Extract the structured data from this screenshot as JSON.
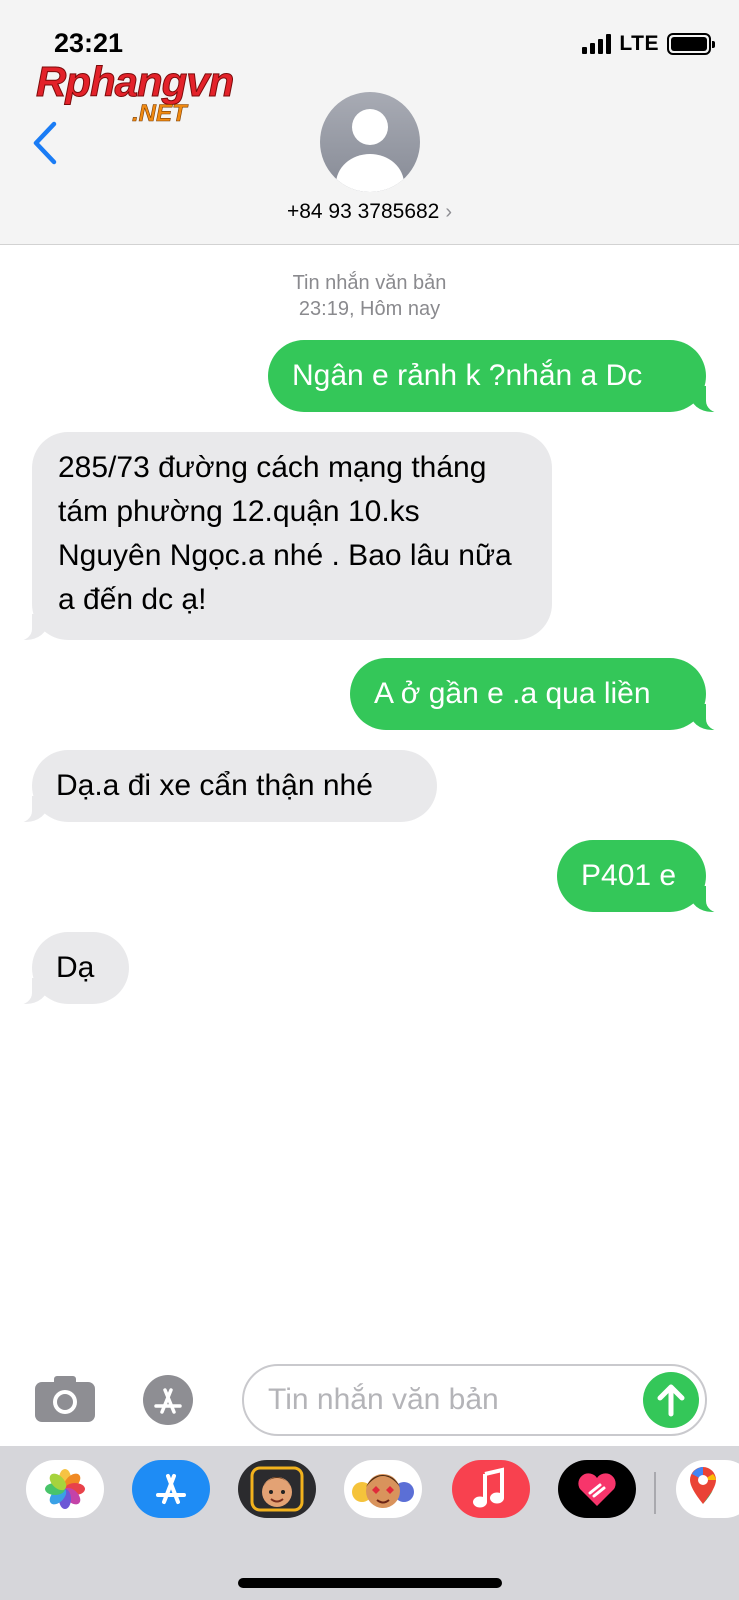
{
  "status_bar": {
    "time": "23:21",
    "network": "LTE"
  },
  "watermark": {
    "top": "Rphangvn",
    "bottom": ".NET"
  },
  "contact": {
    "phone": "+84 93 3785682",
    "chevron": "›"
  },
  "thread": {
    "meta_type": "Tin nhắn văn bản",
    "meta_time": "23:19, Hôm nay"
  },
  "messages": [
    {
      "direction": "outgoing",
      "text": "Ngân e rảnh k ?nhắn a Dc"
    },
    {
      "direction": "incoming",
      "text": "285/73 đường cách mạng tháng tám phường 12.quận 10.ks Nguyên Ngọc.a nhé . Bao lâu nữa a đến dc ạ!"
    },
    {
      "direction": "outgoing",
      "text": "A ở gần e .a qua liền"
    },
    {
      "direction": "incoming",
      "text": "Dạ.a đi xe cẩn thận nhé"
    },
    {
      "direction": "outgoing",
      "text": "P401 e"
    },
    {
      "direction": "incoming",
      "text": "Dạ"
    }
  ],
  "input": {
    "placeholder": "Tin nhắn văn bản"
  },
  "app_drawer": {
    "apps": [
      "photos-icon",
      "app-store-icon",
      "memoji-icon",
      "animoji-icon",
      "music-icon",
      "digital-touch-icon",
      "maps-icon"
    ]
  },
  "colors": {
    "outgoing_bubble": "#34c759",
    "incoming_bubble": "#e9e9eb",
    "accent_blue": "#1a7cf5",
    "header_bg": "#f4f4f4"
  }
}
